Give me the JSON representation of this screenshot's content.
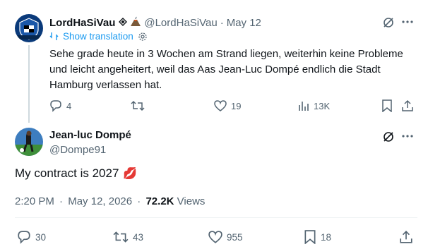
{
  "reply_tweet": {
    "display_name": "LordHaSiVau",
    "handle": "@LordHaSiVau",
    "separator": "·",
    "date": "May 12",
    "translate_label": "Show translation",
    "text_lines": [
      "Sehe grade heute in 3 Wochen am Strand liegen, weiterhin keine Probleme",
      "und leicht angeheitert, weil das Aas Jean-Luc Dompé endlich die Stadt",
      "Hamburg verlassen hat."
    ],
    "actions": {
      "replies": "4",
      "retweets": "",
      "likes": "19",
      "views": "13K"
    }
  },
  "main_tweet": {
    "display_name": "Jean-luc Dompé",
    "handle": "@Dompe91",
    "text": "My contract is 2027",
    "emoji": "💋",
    "time": "2:20 PM",
    "separator": "·",
    "date": "May 12, 2026",
    "separator2": "·",
    "views_count": "72.2K",
    "views_label": "Views",
    "actions": {
      "replies": "30",
      "retweets": "43",
      "likes": "955",
      "bookmarks": "18"
    }
  },
  "icons": {
    "verified": "diamond-badge-icon",
    "volcano": "volcano-emoji-icon",
    "grok": "grok-slash-icon",
    "more": "more-dots-icon",
    "reply": "reply-bubble-icon",
    "retweet": "retweet-icon",
    "like": "heart-icon",
    "views": "bar-chart-icon",
    "bookmark": "bookmark-icon",
    "share": "share-icon",
    "settings": "gear-icon"
  },
  "colors": {
    "accent": "#1d9bf0",
    "muted": "#536471",
    "text": "#0f1419",
    "thread_line": "#cfd9de"
  }
}
